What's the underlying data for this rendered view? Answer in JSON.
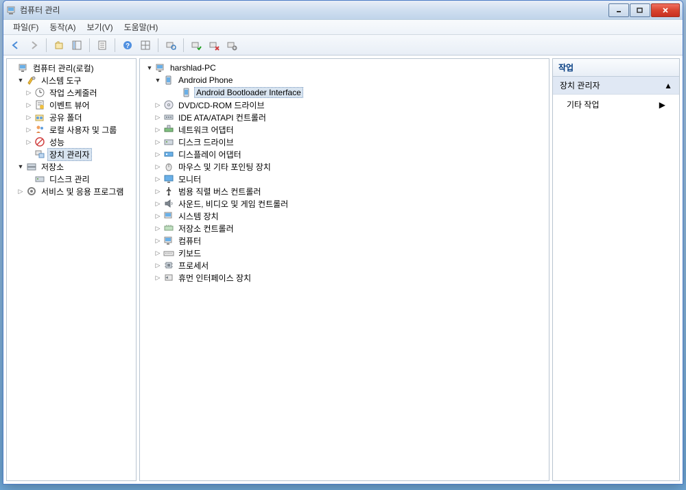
{
  "window": {
    "title": "컴퓨터 관리"
  },
  "menu": {
    "file": "파일(F)",
    "action": "동작(A)",
    "view": "보기(V)",
    "help": "도움말(H)"
  },
  "leftTree": {
    "root": "컴퓨터 관리(로컬)",
    "systemTools": "시스템 도구",
    "taskScheduler": "작업 스케줄러",
    "eventViewer": "이벤트 뷰어",
    "sharedFolders": "공유 폴더",
    "localUsersGroups": "로컬 사용자 및 그룹",
    "performance": "성능",
    "deviceManager": "장치 관리자",
    "storage": "저장소",
    "diskManagement": "디스크 관리",
    "servicesApps": "서비스 및 응용 프로그램"
  },
  "centerTree": {
    "root": "harshlad-PC",
    "androidPhone": "Android Phone",
    "androidBootloader": "Android Bootloader Interface",
    "dvdCdrom": "DVD/CD-ROM 드라이브",
    "ideAtapi": "IDE ATA/ATAPI 컨트롤러",
    "networkAdapters": "네트워크 어댑터",
    "diskDrives": "디스크 드라이브",
    "displayAdapters": "디스플레이 어댑터",
    "mice": "마우스 및 기타 포인팅 장치",
    "monitors": "모니터",
    "usb": "범용 직렬 버스 컨트롤러",
    "sound": "사운드, 비디오 및 게임 컨트롤러",
    "systemDevices": "시스템 장치",
    "storageControllers": "저장소 컨트롤러",
    "computers": "컴퓨터",
    "keyboards": "키보드",
    "processors": "프로세서",
    "hid": "휴먼 인터페이스 장치"
  },
  "rightPane": {
    "title": "작업",
    "section": "장치 관리자",
    "moreActions": "기타 작업"
  }
}
